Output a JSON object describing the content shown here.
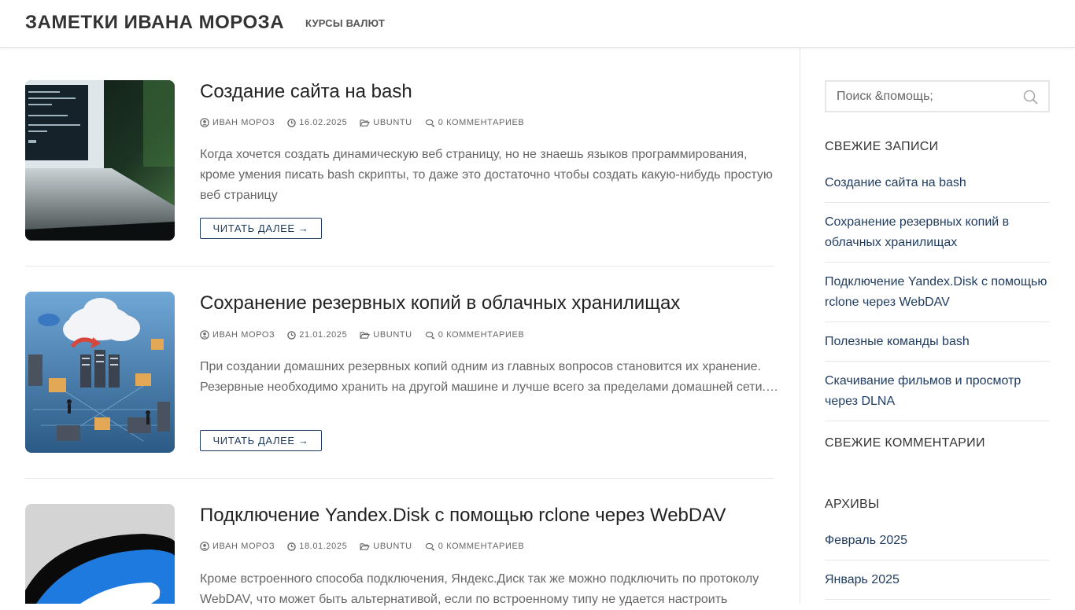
{
  "header": {
    "site_title": "ЗАМЕТКИ ИВАНА МОРОЗА",
    "nav": [
      {
        "label": "КУРСЫ ВАЛЮТ"
      }
    ]
  },
  "posts": [
    {
      "title": "Создание сайта на bash",
      "author": "ИВАН МОРОЗ",
      "date": "16.02.2025",
      "category": "UBUNTU",
      "comments": "0 КОММЕНТАРИЕВ",
      "excerpt": "Когда хочется создать динамическую веб страницу, но не знаешь языков программирования, кроме умения писать bash скрипты, то даже это достаточно чтобы создать какую-нибудь простую веб страницу",
      "read_more": "ЧИТАТЬ ДАЛЕЕ →",
      "thumbnail_icon": "laptop-terminal-image"
    },
    {
      "title": "Сохранение резервных копий в облачных хранилищах",
      "author": "ИВАН МОРОЗ",
      "date": "21.01.2025",
      "category": "UBUNTU",
      "comments": "0 КОММЕНТАРИЕВ",
      "excerpt": "При создании домашних резервных копий одним из главных вопросов становится их хранение. Резервные необходимо хранить на другой машине и лучше всего за пределами домашней сети.…",
      "read_more": "ЧИТАТЬ ДАЛЕЕ →",
      "thumbnail_icon": "cloud-backup-image"
    },
    {
      "title": "Подключение Yandex.Disk с помощью rclone через WebDAV",
      "author": "ИВАН МОРОЗ",
      "date": "18.01.2025",
      "category": "UBUNTU",
      "comments": "0 КОММЕНТАРИЕВ",
      "excerpt": "Кроме встроенного способа подключения, Яндекс.Диск так же можно подключить по протоколу WebDAV, что может быть альтернативой, если по встроенному типу не удается настроить",
      "thumbnail_icon": "yandex-disk-logo-image"
    }
  ],
  "sidebar": {
    "search": {
      "placeholder": "Поиск &помощь;"
    },
    "recent_posts": {
      "title": "СВЕЖИЕ ЗАПИСИ",
      "items": [
        {
          "label": "Создание сайта на bash"
        },
        {
          "label": "Сохранение резервных копий в облачных хранилищах"
        },
        {
          "label": "Подключение Yandex.Disk с помощью rclone через WebDAV"
        },
        {
          "label": "Полезные команды bash"
        },
        {
          "label": "Скачивание фильмов и просмотр через DLNA"
        }
      ]
    },
    "recent_comments": {
      "title": "СВЕЖИЕ КОММЕНТАРИИ"
    },
    "archives": {
      "title": "АРХИВЫ",
      "items": [
        {
          "label": "Февраль 2025"
        },
        {
          "label": "Январь 2025"
        }
      ]
    }
  },
  "colors": {
    "link": "#1e3a5f",
    "text": "#333333",
    "muted": "#666666",
    "border": "#e6e6e6"
  }
}
